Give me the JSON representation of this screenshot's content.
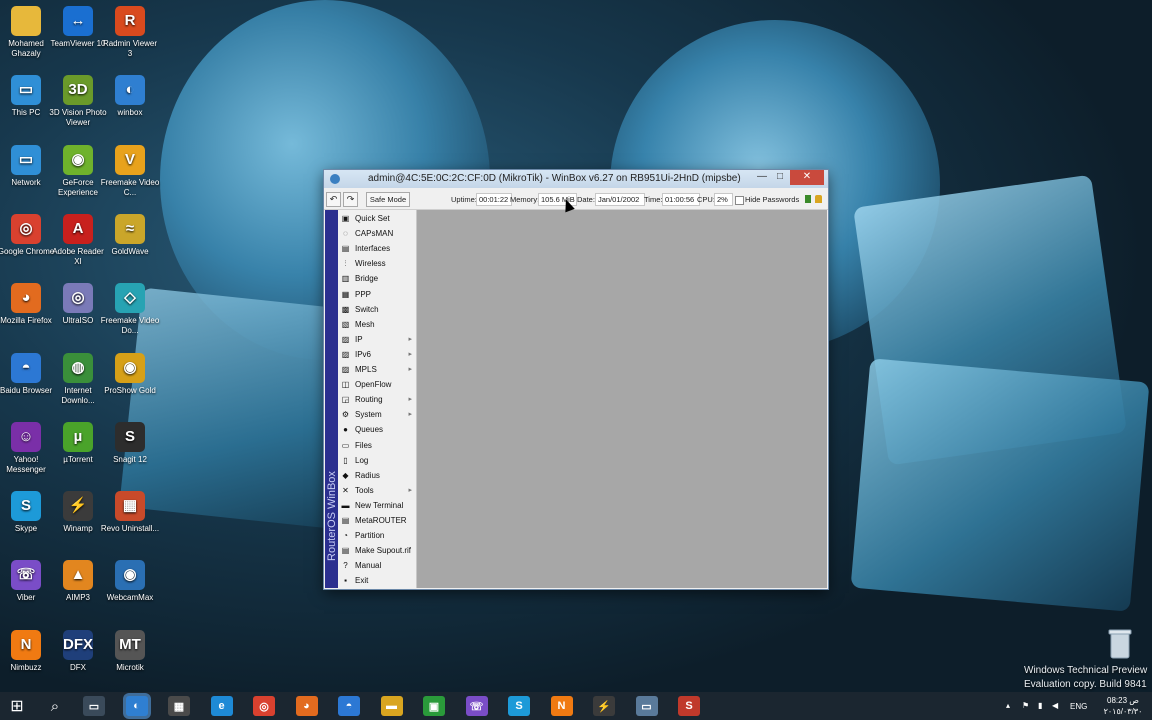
{
  "desktop": {
    "icons": [
      {
        "label": "Mohamed Ghazaly",
        "icon": "folder-icon",
        "glyph": "",
        "color": "#e7b83b"
      },
      {
        "label": "TeamViewer 10",
        "icon": "teamviewer-icon",
        "glyph": "↔",
        "color": "#1a6fd1"
      },
      {
        "label": "Radmin Viewer 3",
        "icon": "radmin-icon",
        "glyph": "R",
        "color": "#d94a1e"
      },
      {
        "label": "This PC",
        "icon": "computer-icon",
        "glyph": "▭",
        "color": "#2f8fd6"
      },
      {
        "label": "3D Vision Photo Viewer",
        "icon": "3d-vision-icon",
        "glyph": "3D",
        "color": "#6a9a2a"
      },
      {
        "label": "winbox",
        "icon": "winbox-icon",
        "glyph": "◐",
        "color": "#2f7fd1"
      },
      {
        "label": "Network",
        "icon": "network-icon",
        "glyph": "▭",
        "color": "#2f8fd6"
      },
      {
        "label": "GeForce Experience",
        "icon": "geforce-icon",
        "glyph": "◉",
        "color": "#6fb22c"
      },
      {
        "label": "Freemake Video C...",
        "icon": "freemake-video-icon",
        "glyph": "V",
        "color": "#e8a21c"
      },
      {
        "label": "Google Chrome",
        "icon": "chrome-icon",
        "glyph": "◎",
        "color": "#d9412f"
      },
      {
        "label": "Adobe Reader XI",
        "icon": "adobe-reader-icon",
        "glyph": "A",
        "color": "#c8201d"
      },
      {
        "label": "GoldWave",
        "icon": "goldwave-icon",
        "glyph": "≈",
        "color": "#caa62a"
      },
      {
        "label": "Mozilla Firefox",
        "icon": "firefox-icon",
        "glyph": "◕",
        "color": "#e26b1f"
      },
      {
        "label": "UltraISO",
        "icon": "ultraiso-icon",
        "glyph": "◎",
        "color": "#7a7ab8"
      },
      {
        "label": "Freemake Video Do...",
        "icon": "freemake-downloader-icon",
        "glyph": "◇",
        "color": "#27a3b3"
      },
      {
        "label": "Baidu Browser",
        "icon": "baidu-browser-icon",
        "glyph": "◓",
        "color": "#2c78d4"
      },
      {
        "label": "Internet Downlo...",
        "icon": "idm-icon",
        "glyph": "◍",
        "color": "#3a8f3a"
      },
      {
        "label": "ProShow Gold",
        "icon": "proshow-icon",
        "glyph": "◉",
        "color": "#d6a018"
      },
      {
        "label": "Yahoo! Messenger",
        "icon": "yahoo-messenger-icon",
        "glyph": "☺",
        "color": "#7a2fa8"
      },
      {
        "label": "µTorrent",
        "icon": "utorrent-icon",
        "glyph": "µ",
        "color": "#4aa32a"
      },
      {
        "label": "Snagit 12",
        "icon": "snagit-icon",
        "glyph": "S",
        "color": "#2d2d2d"
      },
      {
        "label": "Skype",
        "icon": "skype-icon",
        "glyph": "S",
        "color": "#1d9ad8"
      },
      {
        "label": "Winamp",
        "icon": "winamp-icon",
        "glyph": "⚡",
        "color": "#3b3b3b"
      },
      {
        "label": "Revo Uninstall...",
        "icon": "revo-uninstaller-icon",
        "glyph": "▦",
        "color": "#c84a2a"
      },
      {
        "label": "Viber",
        "icon": "viber-icon",
        "glyph": "☏",
        "color": "#7a4dc7"
      },
      {
        "label": "AIMP3",
        "icon": "aimp-icon",
        "glyph": "▲",
        "color": "#e2861f"
      },
      {
        "label": "WebcamMax",
        "icon": "webcammax-icon",
        "glyph": "◉",
        "color": "#2a6fb3"
      },
      {
        "label": "Nimbuzz",
        "icon": "nimbuzz-icon",
        "glyph": "N",
        "color": "#f07a12"
      },
      {
        "label": "DFX",
        "icon": "dfx-icon",
        "glyph": "DFX",
        "color": "#1f3f7a"
      },
      {
        "label": "Microtik",
        "icon": "mikrotik-icon",
        "glyph": "MT",
        "color": "#555555"
      }
    ],
    "watermark": {
      "line1": "Windows Technical Preview",
      "line2": "Evaluation copy. Build 9841"
    }
  },
  "winbox": {
    "title": "admin@4C:5E:0C:2C:CF:0D (MikroTik) - WinBox v6.27 on RB951Ui-2HnD (mipsbe)",
    "controls": {
      "minimize": "—",
      "maximize": "□",
      "close": "✕"
    },
    "toolbar": {
      "undo": "↶",
      "redo": "↷",
      "safe_mode": "Safe Mode",
      "uptime_label": "Uptime:",
      "uptime_value": "00:01:22",
      "memory_label": "Memory:",
      "memory_value": "105.6 MiB",
      "date_label": "Date:",
      "date_value": "Jan/01/2002",
      "time_label": "Time:",
      "time_value": "01:00:56",
      "cpu_label": "CPU:",
      "cpu_value": "2%",
      "hide_passwords": "Hide Passwords"
    },
    "sidebar_text": "RouterOS WinBox",
    "menu": [
      {
        "label": "Quick Set",
        "icon": "quick-set-icon",
        "glyph": "▣",
        "submenu": false
      },
      {
        "label": "CAPsMAN",
        "icon": "capsman-icon",
        "glyph": "◌",
        "submenu": false
      },
      {
        "label": "Interfaces",
        "icon": "interfaces-icon",
        "glyph": "▤",
        "submenu": false
      },
      {
        "label": "Wireless",
        "icon": "wireless-icon",
        "glyph": "⫶",
        "submenu": false
      },
      {
        "label": "Bridge",
        "icon": "bridge-icon",
        "glyph": "▥",
        "submenu": false
      },
      {
        "label": "PPP",
        "icon": "ppp-icon",
        "glyph": "▦",
        "submenu": false
      },
      {
        "label": "Switch",
        "icon": "switch-icon",
        "glyph": "▩",
        "submenu": false
      },
      {
        "label": "Mesh",
        "icon": "mesh-icon",
        "glyph": "▧",
        "submenu": false
      },
      {
        "label": "IP",
        "icon": "ip-icon",
        "glyph": "▨",
        "submenu": true
      },
      {
        "label": "IPv6",
        "icon": "ipv6-icon",
        "glyph": "▨",
        "submenu": true
      },
      {
        "label": "MPLS",
        "icon": "mpls-icon",
        "glyph": "▨",
        "submenu": true
      },
      {
        "label": "OpenFlow",
        "icon": "openflow-icon",
        "glyph": "◫",
        "submenu": false
      },
      {
        "label": "Routing",
        "icon": "routing-icon",
        "glyph": "◲",
        "submenu": true
      },
      {
        "label": "System",
        "icon": "system-icon",
        "glyph": "⚙",
        "submenu": true
      },
      {
        "label": "Queues",
        "icon": "queues-icon",
        "glyph": "●",
        "submenu": false
      },
      {
        "label": "Files",
        "icon": "files-icon",
        "glyph": "▭",
        "submenu": false
      },
      {
        "label": "Log",
        "icon": "log-icon",
        "glyph": "▯",
        "submenu": false
      },
      {
        "label": "Radius",
        "icon": "radius-icon",
        "glyph": "◆",
        "submenu": false
      },
      {
        "label": "Tools",
        "icon": "tools-icon",
        "glyph": "✕",
        "submenu": true
      },
      {
        "label": "New Terminal",
        "icon": "terminal-icon",
        "glyph": "▬",
        "submenu": false
      },
      {
        "label": "MetaROUTER",
        "icon": "metarouter-icon",
        "glyph": "▤",
        "submenu": false
      },
      {
        "label": "Partition",
        "icon": "partition-icon",
        "glyph": "◔",
        "submenu": false
      },
      {
        "label": "Make Supout.rif",
        "icon": "supout-icon",
        "glyph": "▤",
        "submenu": false
      },
      {
        "label": "Manual",
        "icon": "manual-icon",
        "glyph": "?",
        "submenu": false
      },
      {
        "label": "Exit",
        "icon": "exit-icon",
        "glyph": "▪",
        "submenu": false
      }
    ]
  },
  "taskbar": {
    "start": "⊞",
    "search": "⌕",
    "apps": [
      {
        "icon": "task-view-icon",
        "glyph": "▭",
        "color": "#3a4a5a"
      },
      {
        "icon": "winbox-icon",
        "glyph": "◐",
        "color": "#2f7fd1",
        "active": true
      },
      {
        "icon": "network-tool-icon",
        "glyph": "▦",
        "color": "#4a4a4a"
      },
      {
        "icon": "internet-explorer-icon",
        "glyph": "e",
        "color": "#1e8ad6"
      },
      {
        "icon": "chrome-icon",
        "glyph": "◎",
        "color": "#d9412f"
      },
      {
        "icon": "firefox-icon",
        "glyph": "◕",
        "color": "#e26b1f"
      },
      {
        "icon": "baidu-browser-icon",
        "glyph": "◓",
        "color": "#2c78d4"
      },
      {
        "icon": "file-explorer-icon",
        "glyph": "▬",
        "color": "#d9a520"
      },
      {
        "icon": "store-icon",
        "glyph": "▣",
        "color": "#2a9a3a"
      },
      {
        "icon": "viber-icon",
        "glyph": "☏",
        "color": "#7a4dc7"
      },
      {
        "icon": "skype-icon",
        "glyph": "S",
        "color": "#1d9ad8"
      },
      {
        "icon": "nimbuzz-icon",
        "glyph": "N",
        "color": "#f07a12"
      },
      {
        "icon": "winamp-icon",
        "glyph": "⚡",
        "color": "#3b3b3b"
      },
      {
        "icon": "remote-desktop-icon",
        "glyph": "▭",
        "color": "#5a7a9a"
      },
      {
        "icon": "snagit-icon",
        "glyph": "S",
        "color": "#c0392b"
      }
    ],
    "language": "ENG",
    "time": "08:23 ص",
    "date": "٢٠١٥/٠٣/٣٠"
  }
}
